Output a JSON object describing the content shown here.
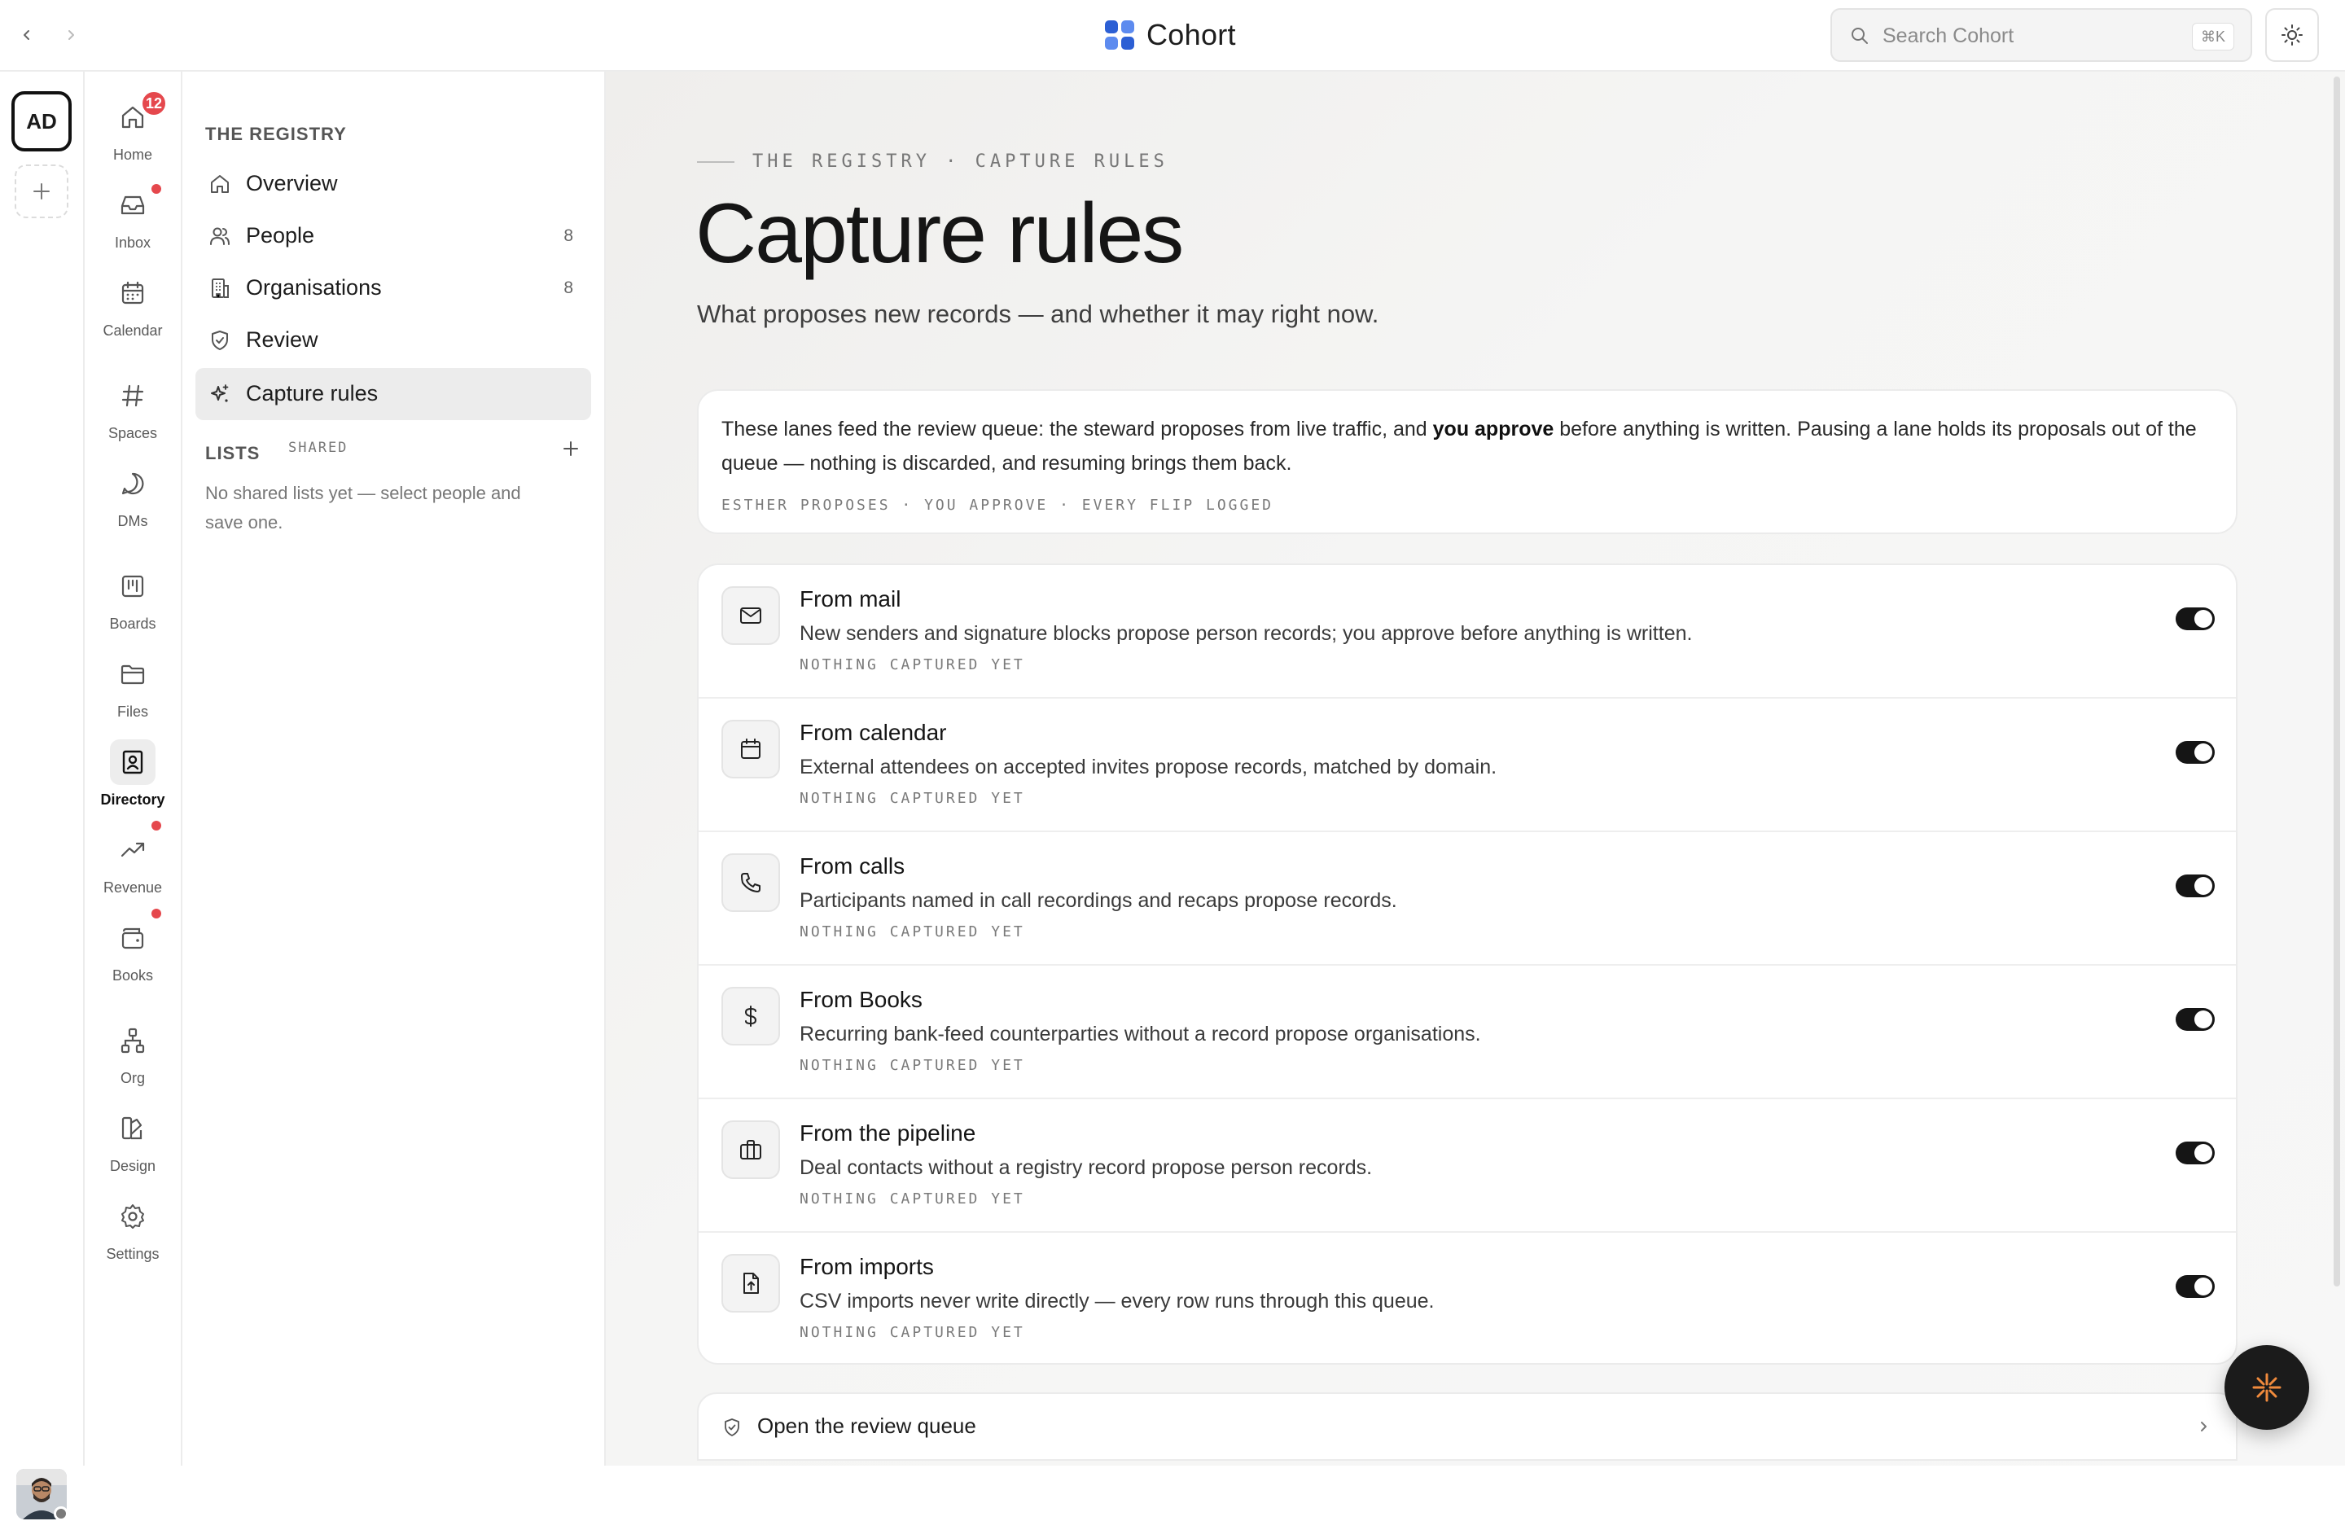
{
  "app": {
    "name": "Cohort",
    "brand_color": "#3b6bd6"
  },
  "topbar": {
    "back_icon": "chevron-left-icon",
    "forward_icon": "chevron-right-icon",
    "search_placeholder": "Search Cohort",
    "search_shortcut": "⌘K",
    "theme_icon": "sun-icon"
  },
  "workspace": {
    "initials": "AD"
  },
  "rail": {
    "home": {
      "label": "Home",
      "badge": "12"
    },
    "inbox": {
      "label": "Inbox"
    },
    "calendar": {
      "label": "Calendar"
    },
    "spaces": {
      "label": "Spaces"
    },
    "dms": {
      "label": "DMs"
    },
    "boards": {
      "label": "Boards"
    },
    "files": {
      "label": "Files"
    },
    "directory": {
      "label": "Directory"
    },
    "revenue": {
      "label": "Revenue"
    },
    "books": {
      "label": "Books"
    },
    "org": {
      "label": "Org"
    },
    "design": {
      "label": "Design"
    },
    "settings": {
      "label": "Settings"
    }
  },
  "sidebar": {
    "section_title": "THE REGISTRY",
    "items": [
      {
        "label": "Overview",
        "count": ""
      },
      {
        "label": "People",
        "count": "8"
      },
      {
        "label": "Organisations",
        "count": "8"
      },
      {
        "label": "Review",
        "count": ""
      },
      {
        "label": "Capture rules",
        "count": ""
      }
    ],
    "lists_title": "LISTS",
    "lists_sub": "SHARED",
    "lists_empty": "No shared lists yet — select people and save one."
  },
  "main": {
    "eyebrow": "THE REGISTRY · CAPTURE RULES",
    "title": "Capture rules",
    "subtitle": "What proposes new records — and whether it may right now.",
    "intro": {
      "text_before": "These lanes feed the review queue: the steward proposes from live traffic, and ",
      "text_bold": "you approve",
      "text_after": " before anything is written. Pausing a lane holds its proposals out of the queue — nothing is discarded, and resuming brings them back.",
      "meta": "ESTHER PROPOSES · YOU APPROVE · EVERY FLIP LOGGED"
    },
    "rules": [
      {
        "icon": "mail-icon",
        "title": "From mail",
        "desc": "New senders and signature blocks propose person records; you approve before anything is written.",
        "status": "NOTHING CAPTURED YET",
        "enabled": true
      },
      {
        "icon": "calendar-icon",
        "title": "From calendar",
        "desc": "External attendees on accepted invites propose records, matched by domain.",
        "status": "NOTHING CAPTURED YET",
        "enabled": true
      },
      {
        "icon": "phone-icon",
        "title": "From calls",
        "desc": "Participants named in call recordings and recaps propose records.",
        "status": "NOTHING CAPTURED YET",
        "enabled": true
      },
      {
        "icon": "dollar-icon",
        "title": "From Books",
        "desc": "Recurring bank-feed counterparties without a record propose organisations.",
        "status": "NOTHING CAPTURED YET",
        "enabled": true
      },
      {
        "icon": "briefcase-icon",
        "title": "From the pipeline",
        "desc": "Deal contacts without a registry record propose person records.",
        "status": "NOTHING CAPTURED YET",
        "enabled": true
      },
      {
        "icon": "file-upload-icon",
        "title": "From imports",
        "desc": "CSV imports never write directly — every row runs through this queue.",
        "status": "NOTHING CAPTURED YET",
        "enabled": true
      }
    ],
    "queue_link": "Open the review queue"
  },
  "fab": {
    "icon": "sparkle-icon",
    "accent": "#f08a3c"
  }
}
